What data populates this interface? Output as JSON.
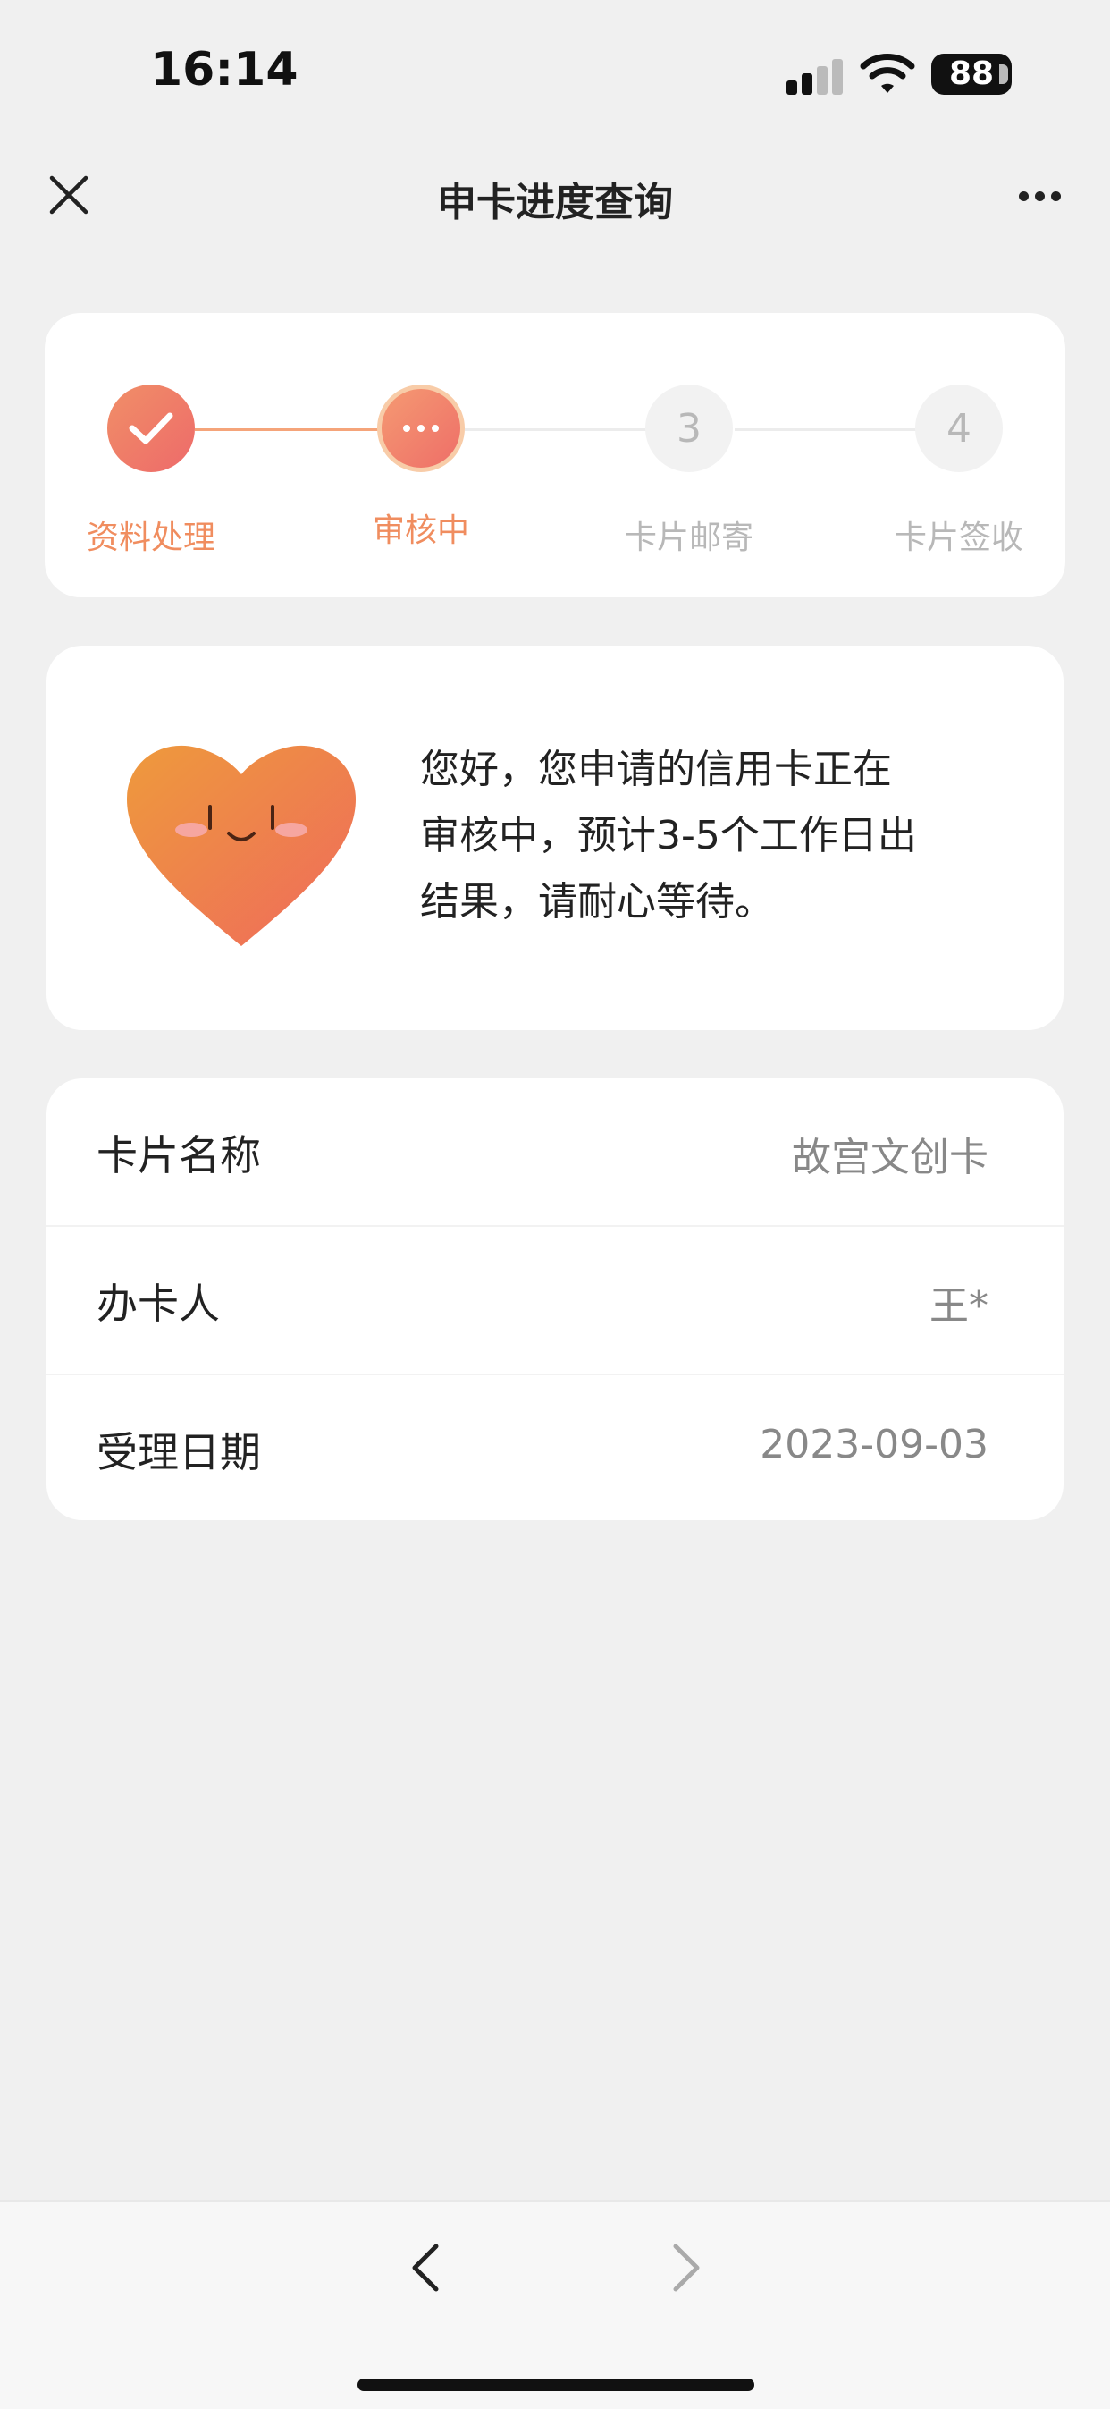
{
  "status_bar": {
    "time": "16:14",
    "battery": "88"
  },
  "nav": {
    "title": "申卡进度查询"
  },
  "steps": [
    {
      "label": "资料处理",
      "state": "done",
      "number": ""
    },
    {
      "label": "审核中",
      "state": "current",
      "number": ""
    },
    {
      "label": "卡片邮寄",
      "state": "pending",
      "number": "3"
    },
    {
      "label": "卡片签收",
      "state": "pending",
      "number": "4"
    }
  ],
  "message": {
    "line1": "您好，您申请的信用卡正在",
    "line2": "审核中，预计3-5个工作日出",
    "line3": "结果，请耐心等待。"
  },
  "info": [
    {
      "label": "卡片名称",
      "value": "故宫文创卡"
    },
    {
      "label": "办卡人",
      "value": "王*"
    },
    {
      "label": "受理日期",
      "value": "2023-09-03"
    }
  ],
  "colors": {
    "accent": "#f08d5f",
    "pending_text": "#b8b8b8",
    "background": "#f0f0f0"
  }
}
